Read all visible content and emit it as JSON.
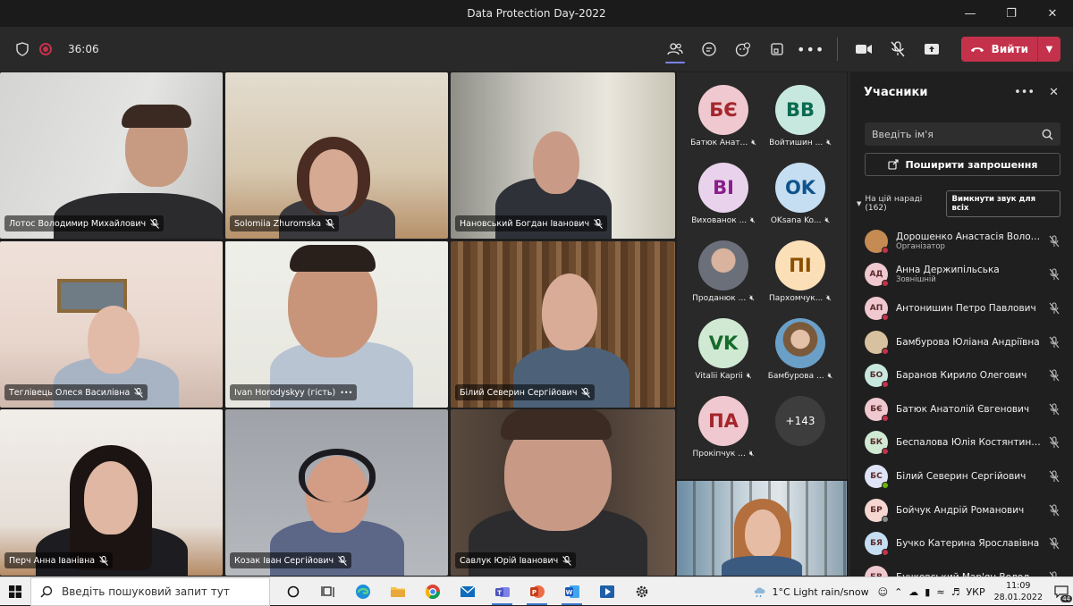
{
  "window": {
    "title": "Data Protection Day-2022"
  },
  "toolbar": {
    "timer": "36:06",
    "leave_label": "Вийти"
  },
  "video_tiles": [
    {
      "name": "Лотос Володимир Михайлович"
    },
    {
      "name": "Solomiia Zhuromska"
    },
    {
      "name": "Нановський Богдан Іванович"
    },
    {
      "name": "Теглівець Олеся Василівна"
    },
    {
      "name": "Ivan Horodyskyy (гість)"
    },
    {
      "name": "Білий Северин Сергійович"
    },
    {
      "name": "Перч Анна Іванівна"
    },
    {
      "name": "Козак Іван Сергійович"
    },
    {
      "name": "Савлук Юрій Іванович"
    }
  ],
  "avatar_tiles": [
    {
      "initials": "БЄ",
      "name": "Батюк Анат...",
      "color": "#f0c8cf"
    },
    {
      "initials": "ВВ",
      "name": "Войтишин ...",
      "color": "#c7e8df"
    },
    {
      "initials": "ВІ",
      "name": "Вихованок ...",
      "color": "#e9d3ec"
    },
    {
      "initials": "OK",
      "name": "OKsana Ko...",
      "color": "#c6def1"
    },
    {
      "initials": "",
      "name": "Проданюк ...",
      "color": "#b0b0b0"
    },
    {
      "initials": "ПІ",
      "name": "Пархомчук...",
      "color": "#fbdfb7"
    },
    {
      "initials": "VK",
      "name": "Vitalii Kaprii",
      "color": "#cfe9d2"
    },
    {
      "initials": "",
      "name": "Бамбурова ...",
      "color": "#d7c19e"
    },
    {
      "initials": "ПА",
      "name": "Прокіпчук ...",
      "color": "#f0c8cf"
    },
    {
      "initials": "+143",
      "name": "",
      "color": "#3d3d3d"
    }
  ],
  "panel": {
    "title": "Учасники",
    "search_placeholder": "Введіть ім'я",
    "share_label": "Поширити запрошення",
    "section_label": "На цій нараді (162)",
    "mute_all_label": "Вимкнути звук для всіх",
    "participants": [
      {
        "initials": "",
        "name": "Дорошенко Анастасія Володи...",
        "role": "Організатор",
        "color": "#c58b52",
        "status": "red"
      },
      {
        "initials": "АД",
        "name": "Анна Держипільська",
        "role": "Зовнішній",
        "color": "#f0c8cf",
        "status": "red"
      },
      {
        "initials": "АП",
        "name": "Антонишин Петро Павлович",
        "role": "",
        "color": "#f0c8cf",
        "status": "red"
      },
      {
        "initials": "",
        "name": "Бамбурова Юліана Андріївна",
        "role": "",
        "color": "#d7c19e",
        "status": "red"
      },
      {
        "initials": "БО",
        "name": "Баранов Кирило Олегович",
        "role": "",
        "color": "#c7e8df",
        "status": "red"
      },
      {
        "initials": "БЄ",
        "name": "Батюк Анатолій Євгенович",
        "role": "",
        "color": "#f0c8cf",
        "status": "red"
      },
      {
        "initials": "БК",
        "name": "Беспалова Юлія Костянтинівна",
        "role": "",
        "color": "#cfe9d2",
        "status": "red"
      },
      {
        "initials": "БС",
        "name": "Білий Северин Сергійович",
        "role": "",
        "color": "#dfe3f6",
        "status": "green"
      },
      {
        "initials": "БР",
        "name": "Бойчук Андрій Романович",
        "role": "",
        "color": "#f6d6d0",
        "status": "grey"
      },
      {
        "initials": "БЯ",
        "name": "Бучко Катерина Ярославівна",
        "role": "",
        "color": "#c6def1",
        "status": "red"
      },
      {
        "initials": "БВ",
        "name": "Бучковський Мар'ян Володим...",
        "role": "",
        "color": "#f0c8cf",
        "status": "red"
      }
    ]
  },
  "taskbar": {
    "search_placeholder": "Введіть пошуковий запит тут",
    "weather": "1°C  Light rain/snow",
    "lang": "УКР",
    "time": "11:09",
    "date": "28.01.2022",
    "notifications": "44"
  }
}
